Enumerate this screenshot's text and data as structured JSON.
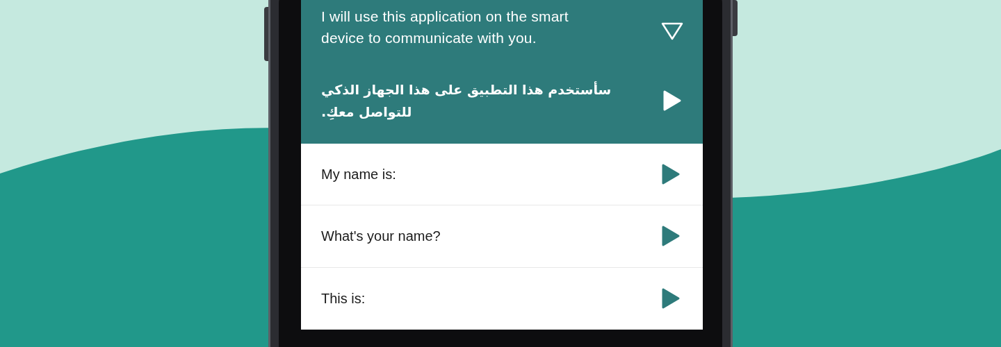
{
  "phrases": [
    {
      "text": "I will use this application on the smart device to communicate with you.",
      "translation": "سأستخدم هذا التطبيق على هذا الجهاز الذكي للتواصل معكِ.",
      "expanded": true
    },
    {
      "text": "My name is:",
      "expanded": false
    },
    {
      "text": "What's your name?",
      "expanded": false
    },
    {
      "text": "This is:",
      "expanded": false
    }
  ]
}
